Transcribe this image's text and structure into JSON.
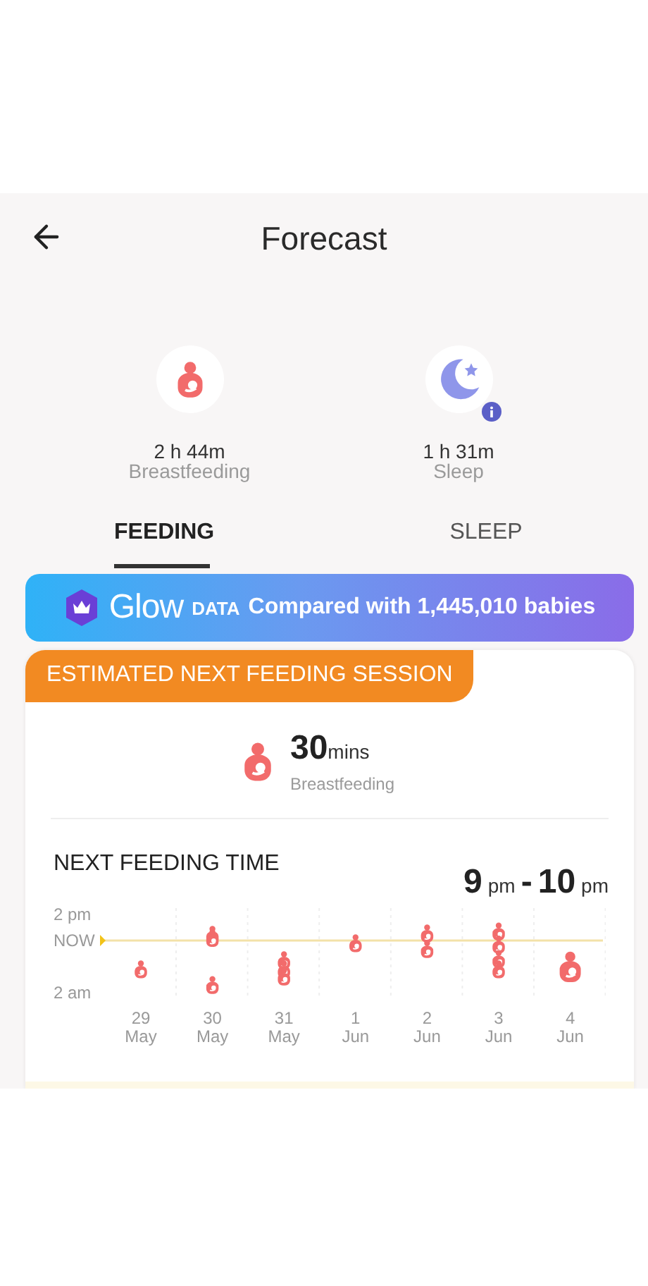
{
  "header": {
    "title": "Forecast"
  },
  "stats": [
    {
      "kind": "feeding",
      "value": "2 h 44m",
      "label": "Breastfeeding",
      "info": false
    },
    {
      "kind": "sleep",
      "value": "1 h 31m",
      "label": "Sleep",
      "info": true
    }
  ],
  "tabs": [
    {
      "label": "FEEDING",
      "selected": true
    },
    {
      "label": "SLEEP",
      "selected": false
    }
  ],
  "banner": {
    "brand": "Glow",
    "tag": "DATA",
    "text": "Compared with 1,445,010 babies"
  },
  "card": {
    "tag": "ESTIMATED NEXT FEEDING SESSION",
    "amount": "30",
    "unit": "mins",
    "type": "Breastfeeding",
    "next": {
      "title": "NEXT FEEDING TIME",
      "from": "9",
      "from_unit": "pm",
      "separator": "-",
      "to": "10",
      "to_unit": "pm",
      "timeline": {
        "y_labels": [
          "2 pm",
          "NOW",
          "2 am"
        ],
        "days": [
          {
            "date": "29",
            "month": "May",
            "forecast": false
          },
          {
            "date": "30",
            "month": "May",
            "forecast": false
          },
          {
            "date": "31",
            "month": "May",
            "forecast": false
          },
          {
            "date": "1",
            "month": "Jun",
            "forecast": false
          },
          {
            "date": "2",
            "month": "Jun",
            "forecast": false
          },
          {
            "date": "3",
            "month": "Jun",
            "forecast": false
          },
          {
            "date": "4",
            "month": "Jun",
            "forecast": true
          }
        ]
      }
    }
  }
}
